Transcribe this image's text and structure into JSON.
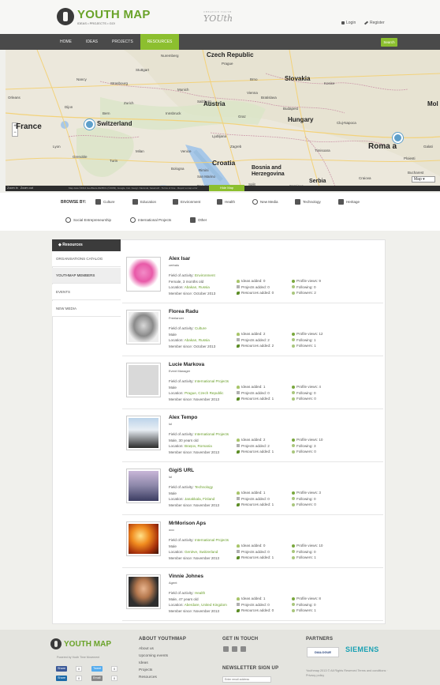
{
  "header": {
    "logo_title": "YOUTH MAP",
    "logo_tag": "IDEAS • PROJECTS • GO!",
    "partner_logo": "YOUth",
    "partner_logo_sub": "CREATIVE YOUTH",
    "login": "Login",
    "register": "Register"
  },
  "nav": {
    "items": [
      "HOME",
      "IDEAS",
      "PROJECTS",
      "RESOURCES"
    ],
    "active": "RESOURCES",
    "search": "Search"
  },
  "map": {
    "labels": {
      "czech": "Czech Republic",
      "slovakia": "Slovakia",
      "austria": "Austria",
      "hungary": "Hungary",
      "france": "France",
      "switzerland": "Switzerland",
      "croatia": "Croatia",
      "bosnia": "Bosnia and Herzegovina",
      "romania": "Roma a",
      "mol": "Mol",
      "serbia": "Serbia",
      "munich": "Munich",
      "vienna": "Vienna",
      "budapest": "Budapest",
      "zagreb": "Zagreb",
      "nuremberg": "Nuremberg",
      "stuttgart": "Stuttgart",
      "milan": "Milan",
      "venice": "Venice",
      "bologna": "Bologna",
      "lyon": "Lyon",
      "grenoble": "Grenoble",
      "turin": "Turin",
      "bern": "Bern",
      "zurich": "Zurich",
      "bratislava": "Bratislava",
      "ljubljana": "Ljubljana",
      "split": "Split",
      "sarajevo": "Sarajevo",
      "bucharest": "Bucharest",
      "cluj": "Cluj-Napoca",
      "timisoara": "Timisoara",
      "kosice": "Kosice",
      "graz": "Graz",
      "salzburg": "Salzburg",
      "innsbruck": "Innsbruck",
      "prague": "Prague",
      "brno": "Brno",
      "dijon": "Dijon",
      "orleans": "Orleans",
      "strasbourg": "Strasbourg",
      "nancy": "Nancy",
      "craiova": "Craiova",
      "ploiesti": "Ploiesti",
      "galati": "Galati",
      "rimini": "Rimini",
      "sanmarino": "San Marino",
      "perugia": "Perugia"
    },
    "hide_map": "Hide Map",
    "map_type": "Map",
    "zoom_in": "Zoom in",
    "zoom_out": "Zoom out",
    "attribution": "Map data ©2014 GeoBasis-DE/BKG (©2009), Google, Inst. Geogr. Nacional, basarsoft · Terms of Use · Report a map error",
    "zoom_plus": "+",
    "zoom_minus": "−"
  },
  "browse": {
    "label": "BROWSE BY:",
    "categories": [
      "Culture",
      "Education",
      "Environment",
      "Health",
      "New Media",
      "Technology",
      "Heritage",
      "Social Entrepreneurship",
      "International Projects",
      "Other"
    ]
  },
  "sidebar": {
    "title": "Resources",
    "items": [
      "ORGANISATIONS CATALOG",
      "YOUTHMAP MEMBERS",
      "EVENTS",
      "NEW MEDIA"
    ],
    "active": "YOUTHMAP MEMBERS"
  },
  "labels": {
    "field": "Field of activity:",
    "location": "Location:",
    "member_since": "Member since:",
    "ideas": "Ideas added:",
    "projects": "Projects added:",
    "resources": "Resources added:",
    "views": "Profile views:",
    "following": "Following:",
    "followers": "Followers:"
  },
  "members": [
    {
      "name": "Alex Isar",
      "role": "cerbalu",
      "field": "Environment",
      "info": "Female, 3 months old",
      "location": "Abakan, Russia",
      "since": "October 2013",
      "ideas": "0",
      "projects": "0",
      "resources": "0",
      "views": "9",
      "following": "0",
      "followers": "2",
      "avatar": "unicorn"
    },
    {
      "name": "Florea Radu",
      "role": "Freelancer",
      "field": "Culture",
      "info": "Male",
      "location": "Abakan, Russia",
      "since": "October 2013",
      "ideas": "2",
      "projects": "2",
      "resources": "2",
      "views": "12",
      "following": "1",
      "followers": "1",
      "avatar": "man-bw"
    },
    {
      "name": "Lucie Markova",
      "role": "Event Manager",
      "field": "International Projects",
      "info": "Male",
      "location": "Prague, Czech Republic",
      "since": "November 2013",
      "ideas": "1",
      "projects": "0",
      "resources": "1",
      "views": "4",
      "following": "0",
      "followers": "0",
      "avatar": "placeholder"
    },
    {
      "name": "Alex Tempo",
      "role": "lol",
      "field": "International Projects",
      "info": "Male, 30 years old",
      "location": "Brașov, Romania",
      "since": "November 2013",
      "ideas": "2",
      "projects": "2",
      "resources": "1",
      "views": "10",
      "following": "3",
      "followers": "0",
      "avatar": "pilot"
    },
    {
      "name": "GigiS URL",
      "role": "lol",
      "field": "Technology",
      "info": "Male",
      "location": "Janakkala, Finland",
      "since": "November 2013",
      "ideas": "1",
      "projects": "0",
      "resources": "1",
      "views": "3",
      "following": "0",
      "followers": "0",
      "avatar": "wave"
    },
    {
      "name": "MrMorison Aps",
      "role": "ooo",
      "field": "International Projects",
      "info": "Male",
      "location": "Genève, Switzerland",
      "since": "November 2013",
      "ideas": "0",
      "projects": "0",
      "resources": "1",
      "views": "10",
      "following": "0",
      "followers": "1",
      "avatar": "fire"
    },
    {
      "name": "Vinnie Johnes",
      "role": "Agent",
      "field": "Health",
      "info": "Male, 47 years old",
      "location": "Aberdare, United Kingdom",
      "since": "November 2013",
      "ideas": "1",
      "projects": "0",
      "resources": "0",
      "views": "8",
      "following": "0",
      "followers": "1",
      "avatar": "man-color"
    }
  ],
  "footer": {
    "logo": "YOUTH MAP",
    "powered": "Powered by Youth Time Movement",
    "about_title": "ABOUT YOUTHMAP",
    "about_links": [
      "About us",
      "Upcoming events",
      "Ideas",
      "Projects",
      "Resources"
    ],
    "touch_title": "GET IN TOUCH",
    "newsletter_title": "NEWSLETTER SIGN UP",
    "newsletter_placeholder": "Enter email address",
    "partners_title": "PARTNERS",
    "partner1": "DIALOGUE",
    "partner2": "SIEMENS",
    "copyright": "Youthmap 2013 © All Rights Reserved Terms and conditions · Privacy policy",
    "share": [
      {
        "label": "Share",
        "count": "0"
      },
      {
        "label": "Tweet",
        "count": "0"
      },
      {
        "label": "Share",
        "count": "0"
      },
      {
        "label": "Email",
        "count": "0"
      }
    ]
  }
}
